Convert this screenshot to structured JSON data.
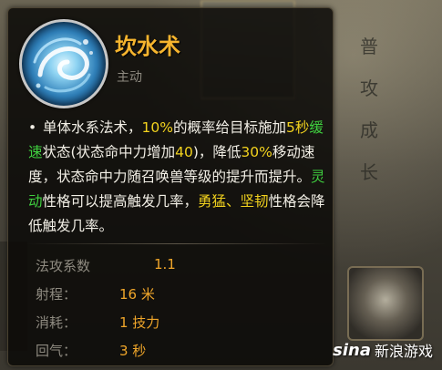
{
  "background": {
    "right_panel_text": "普 攻 成 长"
  },
  "skill": {
    "icon": "water-vortex-icon",
    "name": "坎水术",
    "type": "主动"
  },
  "description": {
    "parts": [
      {
        "text": "单体水系法术，",
        "color": "white"
      },
      {
        "text": "10%",
        "color": "yellow"
      },
      {
        "text": "的概率给目标施加",
        "color": "white"
      },
      {
        "text": "5秒",
        "color": "yellow"
      },
      {
        "text": "缓速",
        "color": "green"
      },
      {
        "text": "状态(状态命中力增加",
        "color": "white"
      },
      {
        "text": "40",
        "color": "yellow"
      },
      {
        "text": ")，降低",
        "color": "white"
      },
      {
        "text": "30%",
        "color": "yellow"
      },
      {
        "text": "移动速度，状态命中力随召唤兽等级的提升而提升。",
        "color": "white"
      },
      {
        "text": "灵动",
        "color": "green"
      },
      {
        "text": "性格可以提高触发几率，",
        "color": "white"
      },
      {
        "text": "勇猛、坚韧",
        "color": "yellow"
      },
      {
        "text": "性格会降低触发几率。",
        "color": "white"
      }
    ]
  },
  "stats": [
    {
      "label": "法攻系数",
      "value": "1.1"
    },
    {
      "label": "射程：",
      "value": "16 米"
    },
    {
      "label": "消耗：",
      "value": "1 技力"
    },
    {
      "label": "回气：",
      "value": "3 秒"
    }
  ],
  "watermark": {
    "brand": "sina",
    "text": "新浪游戏"
  },
  "colors": {
    "title": "#f5b42e",
    "yellow": "#f2d21e",
    "green": "#3fcf3f",
    "value": "#f0a62a"
  }
}
